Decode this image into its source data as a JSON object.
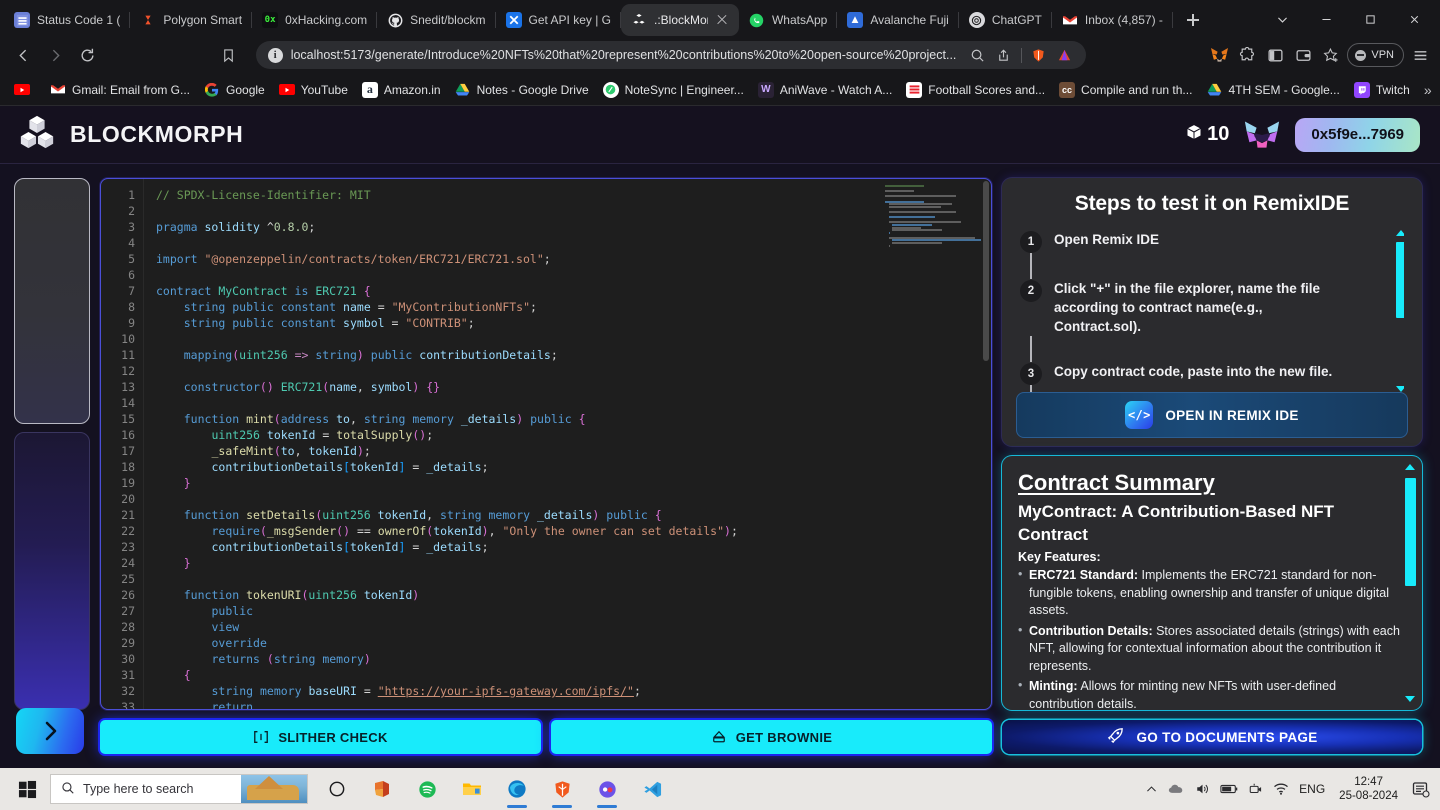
{
  "browser": {
    "tabs": [
      {
        "label": "Status Code 1 (",
        "icon": "sheets-icon",
        "active": false
      },
      {
        "label": "Polygon Smart",
        "icon": "polygon-icon",
        "active": false
      },
      {
        "label": "0xHacking.com",
        "icon": "zerox-icon",
        "active": false
      },
      {
        "label": "Snedit/blockm",
        "icon": "github-icon",
        "active": false
      },
      {
        "label": "Get API key | G",
        "icon": "gemini-icon",
        "active": false
      },
      {
        "label": ".:BlockMor",
        "icon": "blockmorph-icon",
        "active": true
      },
      {
        "label": "WhatsApp",
        "icon": "whatsapp-icon",
        "active": false
      },
      {
        "label": "Avalanche Fuji",
        "icon": "avalanche-icon",
        "active": false
      },
      {
        "label": "ChatGPT",
        "icon": "chatgpt-icon",
        "active": false
      },
      {
        "label": "Inbox (4,857) -",
        "icon": "gmail-icon",
        "active": false
      }
    ],
    "url": "localhost:5173/generate/Introduce%20NFTs%20that%20represent%20contributions%20to%20open-source%20project...",
    "vpn_label": "VPN",
    "bookmarks": [
      {
        "label": "",
        "icon": "youtube-icon"
      },
      {
        "label": "Gmail: Email from G...",
        "icon": "gmail-icon"
      },
      {
        "label": "Google",
        "icon": "google-icon"
      },
      {
        "label": "YouTube",
        "icon": "youtube-icon"
      },
      {
        "label": "Amazon.in",
        "icon": "amazon-icon"
      },
      {
        "label": "Notes - Google Drive",
        "icon": "drive-icon"
      },
      {
        "label": "NoteSync | Engineer...",
        "icon": "notesync-icon"
      },
      {
        "label": "AniWave - Watch A...",
        "icon": "aniwave-icon"
      },
      {
        "label": "Football Scores and...",
        "icon": "football-icon"
      },
      {
        "label": "Compile and run th...",
        "icon": "cc-icon"
      },
      {
        "label": "4TH SEM - Google...",
        "icon": "drive-icon"
      },
      {
        "label": "Twitch",
        "icon": "twitch-icon"
      }
    ],
    "overflow_label": "»"
  },
  "app": {
    "brand": "BLOCKMORPH",
    "credits": "10",
    "wallet_address": "0x5f9e...7969"
  },
  "editor": {
    "lines": [
      "// SPDX-License-Identifier: MIT",
      "",
      "pragma solidity ^0.8.0;",
      "",
      "import \"@openzeppelin/contracts/token/ERC721/ERC721.sol\";",
      "",
      "contract MyContract is ERC721 {",
      "    string public constant name = \"MyContributionNFTs\";",
      "    string public constant symbol = \"CONTRIB\";",
      "",
      "    mapping(uint256 => string) public contributionDetails;",
      "",
      "    constructor() ERC721(name, symbol) {}",
      "",
      "    function mint(address to, string memory _details) public {",
      "        uint256 tokenId = totalSupply();",
      "        _safeMint(to, tokenId);",
      "        contributionDetails[tokenId] = _details;",
      "    }",
      "",
      "    function setDetails(uint256 tokenId, string memory _details) public {",
      "        require(_msgSender() == ownerOf(tokenId), \"Only the owner can set details\");",
      "        contributionDetails[tokenId] = _details;",
      "    }",
      "",
      "    function tokenURI(uint256 tokenId)",
      "        public",
      "        view",
      "        override",
      "        returns (string memory)",
      "    {",
      "        string memory baseURI = \"https://your-ipfs-gateway.com/ipfs/\";",
      "        return"
    ],
    "first_line_number": 1,
    "last_visible_line_number": 33
  },
  "actions": {
    "slither_check": "SLITHER CHECK",
    "get_brownie": "GET BROWNIE",
    "go_to_documents": "GO TO DOCUMENTS PAGE"
  },
  "steps_panel": {
    "title": "Steps to test it on RemixIDE",
    "steps": [
      {
        "number": "1",
        "text": "Open Remix IDE"
      },
      {
        "number": "2",
        "text": "Click \"+\" in the file explorer, name the file according to contract name(e.g., Contract.sol)."
      },
      {
        "number": "3",
        "text": "Copy contract code, paste into the new file."
      }
    ],
    "open_remix_label": "OPEN IN REMIX IDE",
    "remix_icon_text": "</>"
  },
  "summary_panel": {
    "title": "Contract Summary",
    "subtitle": "MyContract: A Contribution-Based NFT Contract",
    "key_features_label": "Key Features:",
    "features": [
      {
        "term": "ERC721 Standard:",
        "text": " Implements the ERC721 standard for non-fungible tokens, enabling ownership and transfer of unique digital assets."
      },
      {
        "term": "Contribution Details:",
        "text": " Stores associated details (strings) with each NFT, allowing for contextual information about the contribution it represents."
      },
      {
        "term": "Minting:",
        "text": " Allows for minting new NFTs with user-defined contribution details."
      }
    ]
  },
  "taskbar": {
    "search_placeholder": "Type here to search",
    "language": "ENG",
    "time": "12:47",
    "date": "25-08-2024",
    "apps": [
      {
        "name": "cortana-icon"
      },
      {
        "name": "office-icon"
      },
      {
        "name": "spotify-icon"
      },
      {
        "name": "file-explorer-icon"
      },
      {
        "name": "edge-icon"
      },
      {
        "name": "brave-icon"
      },
      {
        "name": "discord-icon"
      },
      {
        "name": "vscode-icon"
      }
    ]
  },
  "colors": {
    "accent_cyan": "#18ebfb",
    "accent_blue": "#1b26f0",
    "page_bg": "#141120",
    "header_bg": "#15111f",
    "card_bg": "#2b2b2e"
  }
}
